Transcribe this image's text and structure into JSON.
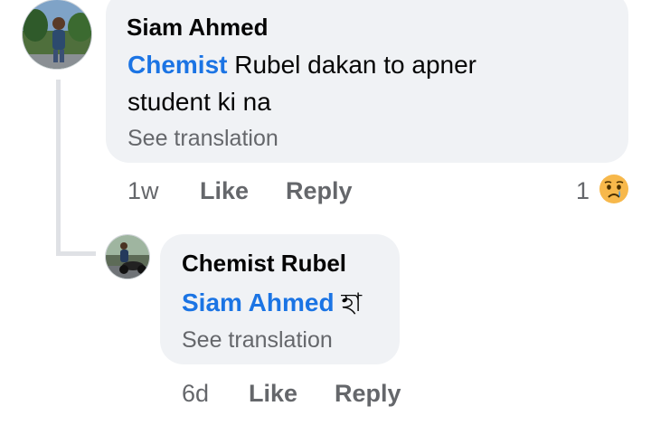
{
  "comment": {
    "author": "Siam Ahmed",
    "mention": "Chemist",
    "text_line1": " Rubel dakan to apner",
    "text_line2": "student  ki na",
    "see_translation": "See translation",
    "time": "1w",
    "like_label": "Like",
    "reply_label": "Reply",
    "reaction_count": "1",
    "reaction_icon": "crying-face-icon"
  },
  "reply": {
    "author": "Chemist Rubel",
    "mention": "Siam Ahmed",
    "text": " হা",
    "see_translation": "See translation",
    "time": "6d",
    "like_label": "Like",
    "reply_label": "Reply"
  },
  "colors": {
    "bubble_bg": "#f0f2f5",
    "mention": "#1b74e4",
    "meta_text": "#65676b",
    "thread_line": "#dfe1e5"
  }
}
